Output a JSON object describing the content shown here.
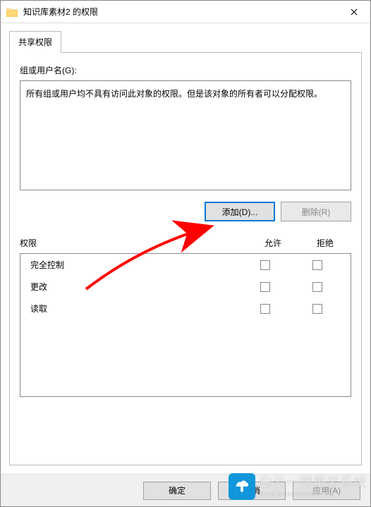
{
  "titlebar": {
    "title": "知识库素材2 的权限"
  },
  "tabs": {
    "active_label": "共享权限"
  },
  "group_users": {
    "label": "组或用户名(G):",
    "message": "所有组或用户均不具有访问此对象的权限。但是该对象的所有者可以分配权限。"
  },
  "buttons": {
    "add": "添加(D)...",
    "remove": "删除(R)"
  },
  "permissions": {
    "header_name": "权限",
    "header_allow": "允许",
    "header_deny": "拒绝",
    "rows": [
      {
        "name": "完全控制"
      },
      {
        "name": "更改"
      },
      {
        "name": "读取"
      }
    ]
  },
  "dialog_buttons": {
    "ok": "确定",
    "cancel": "取消",
    "apply": "应用(A)"
  },
  "watermark": {
    "line1": "白云一键重装系统",
    "line2": "www.baiyunxitong.com"
  },
  "annotation": {
    "type": "arrow",
    "color": "#ff0000",
    "points_to": "add-button"
  }
}
